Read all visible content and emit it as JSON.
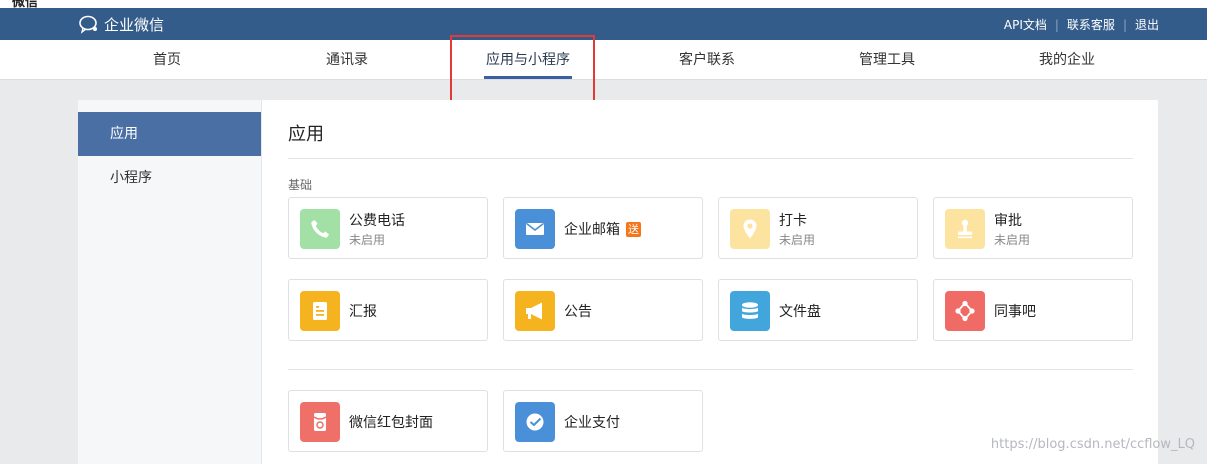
{
  "top_strip": {
    "text": "微信"
  },
  "brand": {
    "name": "企业微信",
    "icon": "wecom-logo-icon"
  },
  "top_links": [
    {
      "label": "API文档"
    },
    {
      "label": "联系客服"
    },
    {
      "label": "退出"
    }
  ],
  "nav": {
    "items": [
      {
        "label": "首页"
      },
      {
        "label": "通讯录"
      },
      {
        "label": "应用与小程序",
        "active": true
      },
      {
        "label": "客户联系"
      },
      {
        "label": "管理工具"
      },
      {
        "label": "我的企业"
      }
    ]
  },
  "sidebar": {
    "items": [
      {
        "label": "应用",
        "active": true
      },
      {
        "label": "小程序"
      }
    ]
  },
  "main": {
    "title": "应用",
    "section_basic": "基础",
    "apps": [
      {
        "name": "公费电话",
        "status": "未启用",
        "icon": "phone-icon",
        "color": "#a3e0a6"
      },
      {
        "name": "企业邮箱",
        "badge": "送",
        "icon": "mail-icon",
        "color": "#4a90d9"
      },
      {
        "name": "打卡",
        "status": "未启用",
        "icon": "location-pin-icon",
        "color": "#fde3a0"
      },
      {
        "name": "审批",
        "status": "未启用",
        "icon": "stamp-icon",
        "color": "#fde3a0"
      },
      {
        "name": "汇报",
        "icon": "report-icon",
        "color": "#f5b31f"
      },
      {
        "name": "公告",
        "icon": "megaphone-icon",
        "color": "#f5b31f"
      },
      {
        "name": "文件盘",
        "icon": "database-icon",
        "color": "#42a5dc"
      },
      {
        "name": "同事吧",
        "icon": "network-icon",
        "color": "#f16b66"
      }
    ],
    "more_apps": [
      {
        "name": "微信红包封面",
        "icon": "red-packet-icon",
        "color": "#ef6f69"
      },
      {
        "name": "企业支付",
        "icon": "payment-icon",
        "color": "#4a90d9"
      }
    ]
  },
  "watermark": "https://blog.csdn.net/ccflow_LQ"
}
